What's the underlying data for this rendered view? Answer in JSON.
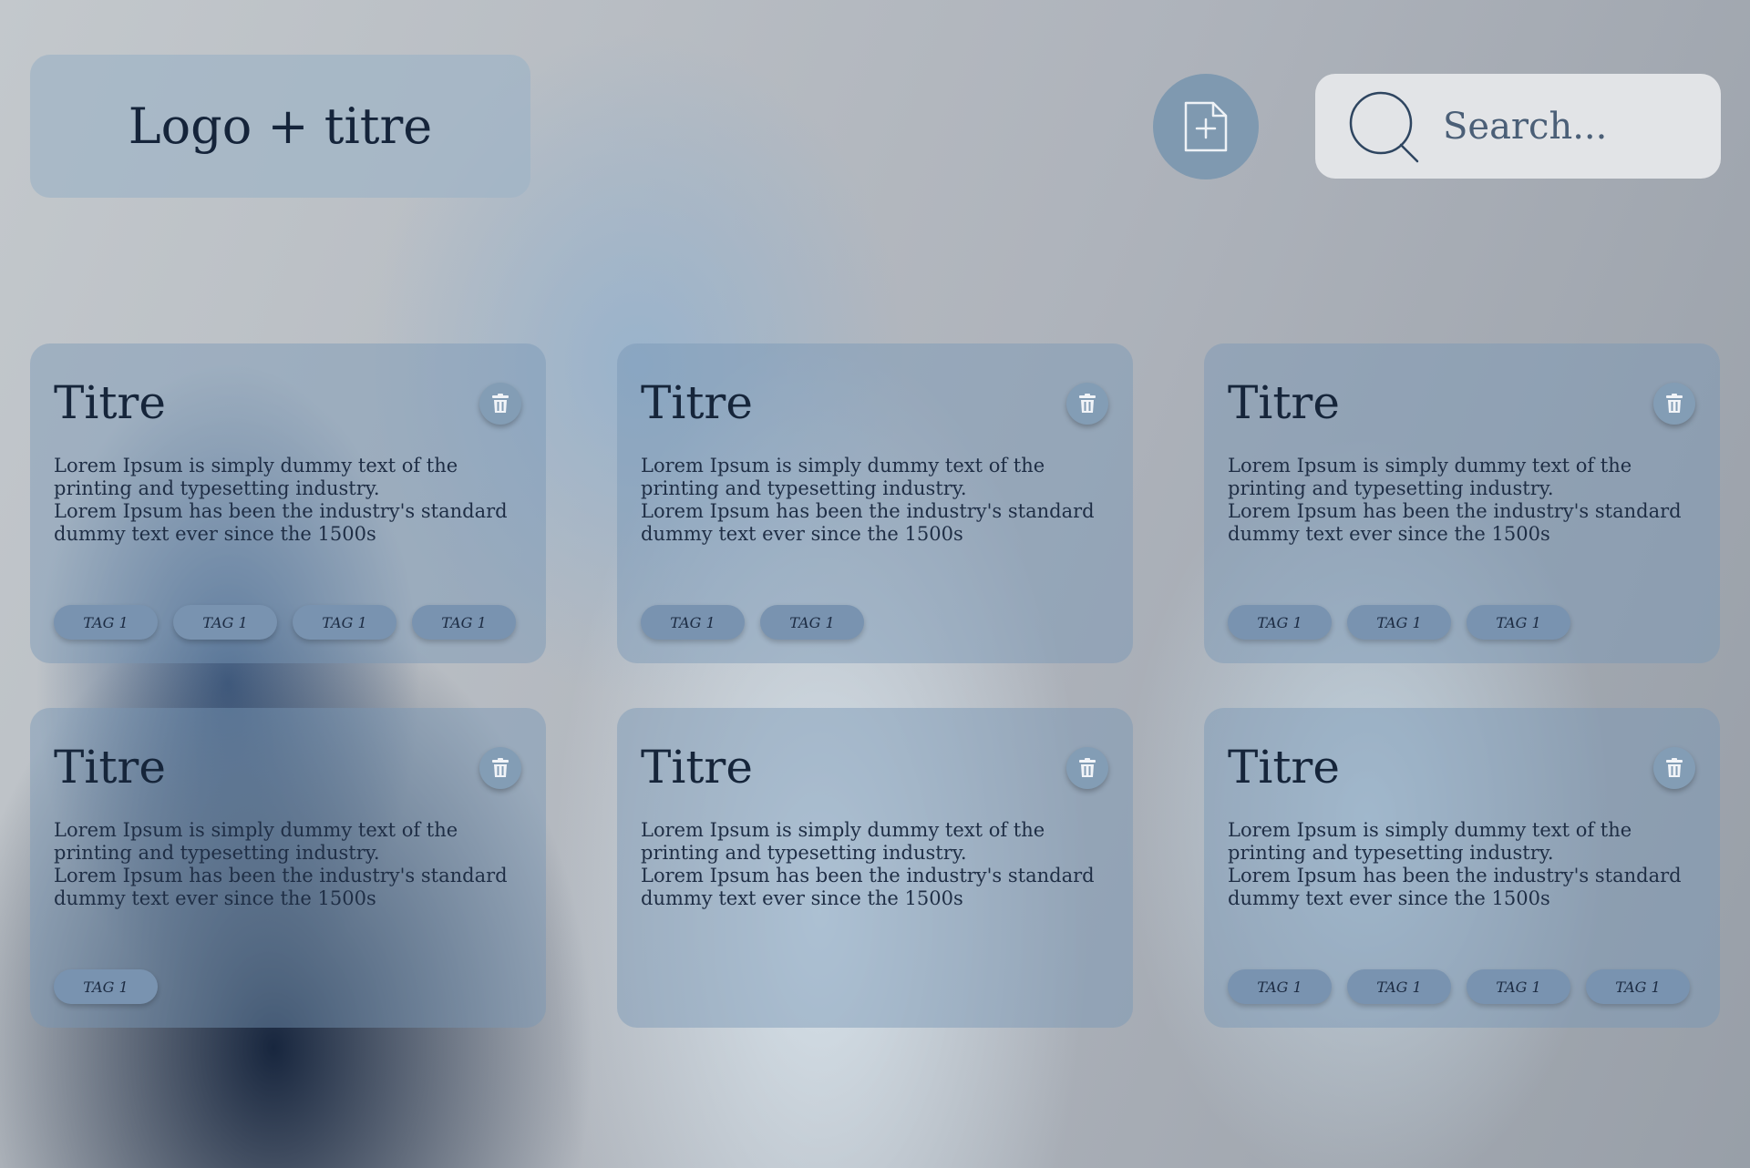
{
  "header": {
    "logo_title": "Logo + titre",
    "add_label": "+",
    "search_placeholder": "Search..."
  },
  "cards": [
    {
      "title": "Titre",
      "line1": "Lorem Ipsum is simply dummy text of the printing and typesetting industry.",
      "line2": "Lorem Ipsum has been the industry's standard dummy text ever since the 1500s",
      "tags": [
        "TAG 1",
        "TAG 1",
        "TAG 1",
        "TAG 1"
      ]
    },
    {
      "title": "Titre",
      "line1": "Lorem Ipsum is simply dummy text of the printing and typesetting industry.",
      "line2": "Lorem Ipsum has been the industry's standard dummy text ever since the 1500s",
      "tags": [
        "TAG 1",
        "TAG 1"
      ]
    },
    {
      "title": "Titre",
      "line1": "Lorem Ipsum is simply dummy text of the printing and typesetting industry.",
      "line2": "Lorem Ipsum has been the industry's standard dummy text ever since the 1500s",
      "tags": [
        "TAG 1",
        "TAG 1",
        "TAG 1"
      ]
    },
    {
      "title": "Titre",
      "line1": "Lorem Ipsum is simply dummy text of the printing and typesetting industry.",
      "line2": "Lorem Ipsum has been the industry's standard dummy text ever since the 1500s",
      "tags": [
        "TAG 1"
      ]
    },
    {
      "title": "Titre",
      "line1": "Lorem Ipsum is simply dummy text of the printing and typesetting industry.",
      "line2": "Lorem Ipsum has been the industry's standard dummy text ever since the 1500s",
      "tags": []
    },
    {
      "title": "Titre",
      "line1": "Lorem Ipsum is simply dummy text of the printing and typesetting industry.",
      "line2": "Lorem Ipsum has been the industry's standard dummy text ever since the 1500s",
      "tags": [
        "TAG 1",
        "TAG 1",
        "TAG 1",
        "TAG 1"
      ]
    }
  ],
  "colors": {
    "card_bg": "#7896b6",
    "tag_bg": "#7993b0",
    "text_dark": "#16253a",
    "search_bg": "#e2e4e7"
  }
}
